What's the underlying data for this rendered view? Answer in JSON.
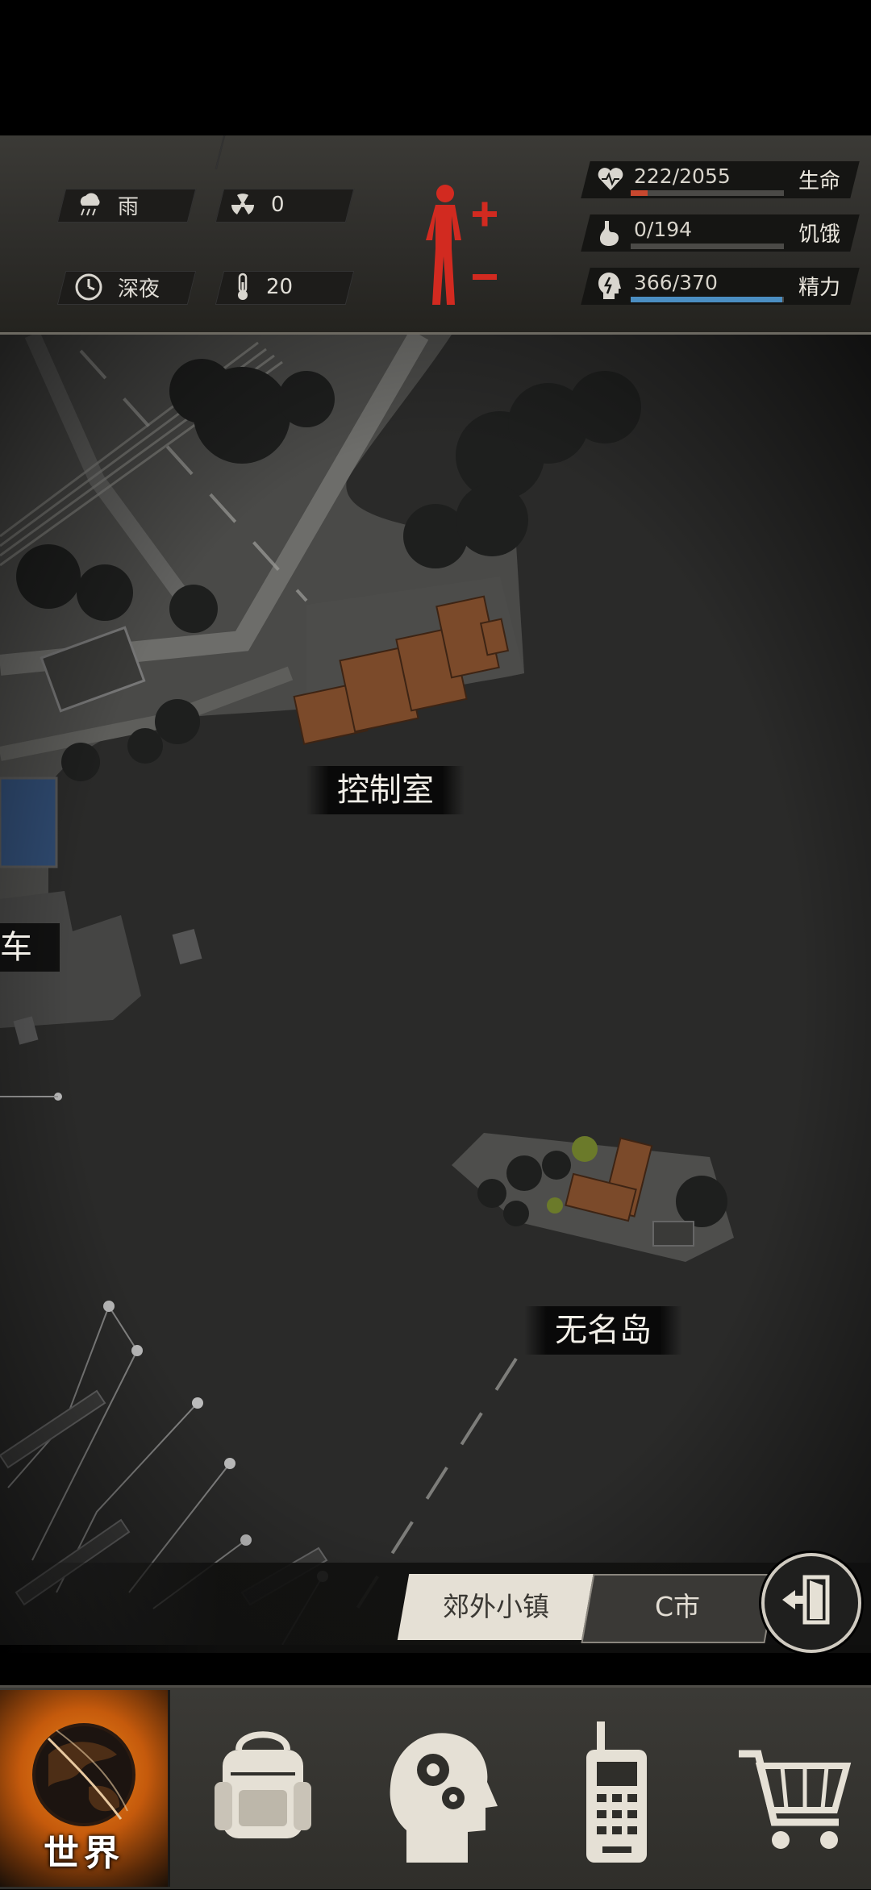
{
  "hud": {
    "weather_label": "雨",
    "radiation_value": "0",
    "time_label": "深夜",
    "temperature_value": "20",
    "stats": [
      {
        "name": "生命",
        "value_text": "222/2055",
        "fill": 0.108,
        "color": "#c8482f"
      },
      {
        "name": "饥饿",
        "value_text": "0/194",
        "fill": 0.0,
        "color": "#8a8a8a"
      },
      {
        "name": "精力",
        "value_text": "366/370",
        "fill": 0.989,
        "color": "#4b8ec2"
      }
    ]
  },
  "map": {
    "locations": {
      "control_room": "控制室",
      "nameless_island": "无名岛",
      "workshop_partial": "车间"
    }
  },
  "regions": {
    "tab1": "郊外小镇",
    "tab2": "C市"
  },
  "nav": {
    "world_label": "世界"
  },
  "colors": {
    "health": "#c8482f",
    "energy": "#4b8ec2",
    "body_figure": "#d22a20",
    "world_glow": "#f08a1c"
  },
  "icons": [
    "rain-icon",
    "radiation-icon",
    "clock-icon",
    "thermometer-icon",
    "heart-icon",
    "stomach-icon",
    "head-energy-icon",
    "body-status-icon",
    "exit-door-icon",
    "globe-icon",
    "backpack-icon",
    "brain-skills-icon",
    "radio-icon",
    "shopping-cart-icon"
  ]
}
